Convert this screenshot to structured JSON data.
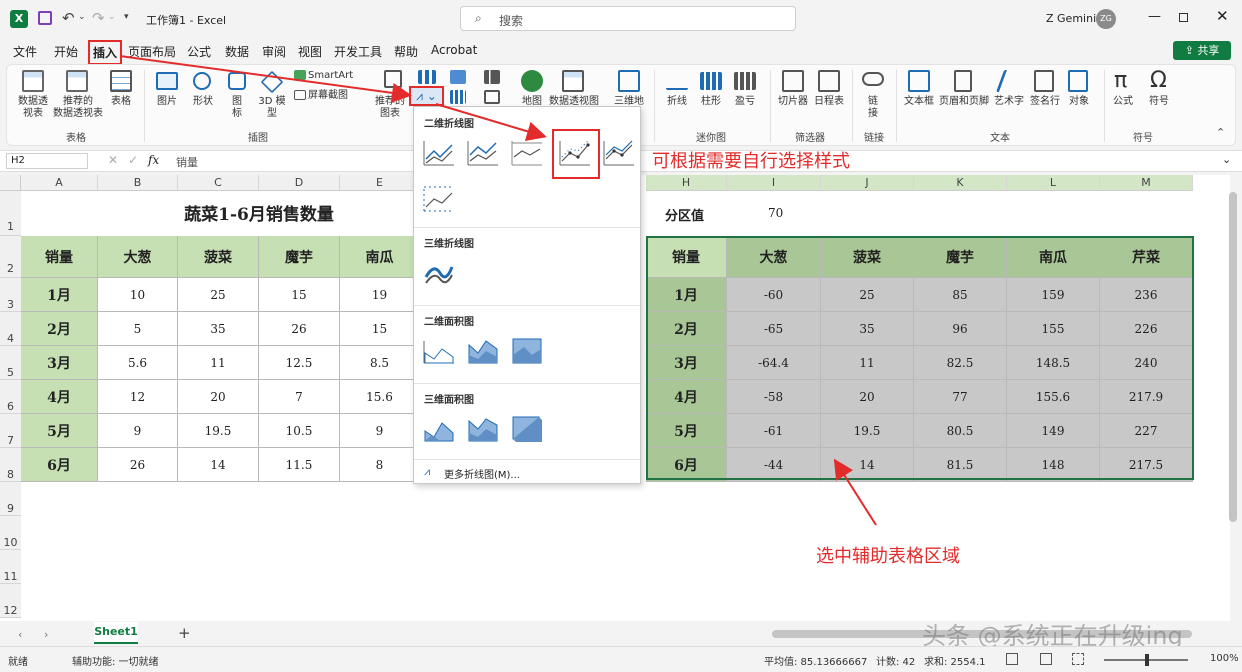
{
  "title_bar": {
    "window_title": "工作簿1 - Excel",
    "search_placeholder": "搜索",
    "user_name": "Z Gemini",
    "user_initials": "ZG"
  },
  "menu": {
    "tabs": [
      "文件",
      "开始",
      "插入",
      "页面布局",
      "公式",
      "数据",
      "审阅",
      "视图",
      "开发工具",
      "帮助",
      "Acrobat"
    ],
    "share": "共享"
  },
  "ribbon": {
    "buttons": {
      "pivot": "数据透\n视表",
      "rec_pivot": "推荐的\n数据透视表",
      "table": "表格",
      "picture": "图片",
      "shapes": "形状",
      "icons": "图\n标",
      "models3d": "3D 模\n型",
      "smartart": "SmartArt",
      "screenshot": "屏幕截图",
      "rec_chart": "推荐的\n图表",
      "map": "地图",
      "pivot_chart": "数据透视图",
      "chart3d": "三维地",
      "spark_line": "折线",
      "spark_col": "柱形",
      "spark_wl": "盈亏",
      "slicer": "切片器",
      "timeline": "日程表",
      "link": "链\n接",
      "textbox": "文本框",
      "header_footer": "页眉和页脚",
      "wordart": "艺术字",
      "signature": "签名行",
      "object": "对象",
      "formula": "公式",
      "symbol": "符号"
    },
    "groups": {
      "tables": "表格",
      "illustrations": "插图",
      "sparklines": "迷你图",
      "filters": "筛选器",
      "links": "链接",
      "text": "文本",
      "symbols": "符号"
    }
  },
  "formula_bar": {
    "name_box": "H2",
    "fx": "fx",
    "content": "销量"
  },
  "columns": [
    "A",
    "B",
    "C",
    "D",
    "E",
    "H",
    "I",
    "J",
    "K",
    "L",
    "M"
  ],
  "rows": [
    "1",
    "2",
    "3",
    "4",
    "5",
    "6",
    "7",
    "8",
    "9",
    "10",
    "11",
    "12"
  ],
  "left_table": {
    "title": "蔬菜1-6月销售数量",
    "headers": [
      "销量",
      "大葱",
      "菠菜",
      "魔芋",
      "南瓜"
    ],
    "rows": [
      [
        "1月",
        "10",
        "25",
        "15",
        "19"
      ],
      [
        "2月",
        "5",
        "35",
        "26",
        "15"
      ],
      [
        "3月",
        "5.6",
        "11",
        "12.5",
        "8.5"
      ],
      [
        "4月",
        "12",
        "20",
        "7",
        "15.6"
      ],
      [
        "5月",
        "9",
        "19.5",
        "10.5",
        "9"
      ],
      [
        "6月",
        "26",
        "14",
        "11.5",
        "8"
      ]
    ]
  },
  "right_table": {
    "partition_label": "分区值",
    "partition_value": "70",
    "headers": [
      "销量",
      "大葱",
      "菠菜",
      "魔芋",
      "南瓜",
      "芹菜"
    ],
    "rows": [
      [
        "1月",
        "-60",
        "25",
        "85",
        "159",
        "236"
      ],
      [
        "2月",
        "-65",
        "35",
        "96",
        "155",
        "226"
      ],
      [
        "3月",
        "-64.4",
        "11",
        "82.5",
        "148.5",
        "240"
      ],
      [
        "4月",
        "-58",
        "20",
        "77",
        "155.6",
        "217.9"
      ],
      [
        "5月",
        "-61",
        "19.5",
        "80.5",
        "149",
        "227"
      ],
      [
        "6月",
        "-44",
        "14",
        "81.5",
        "148",
        "217.5"
      ]
    ]
  },
  "dropdown": {
    "sec1": "二维折线图",
    "sec2": "三维折线图",
    "sec3": "二维面积图",
    "sec4": "三维面积图",
    "more": "更多折线图(M)..."
  },
  "annotations": {
    "style_tip": "可根据需要自行选择样式",
    "select_tip": "选中辅助表格区域"
  },
  "sheet": {
    "tab": "Sheet1",
    "add": "+"
  },
  "status": {
    "ready": "就绪",
    "accessibility": "辅助功能: 一切就绪",
    "average": "平均值: 85.13666667",
    "count": "计数: 42",
    "sum": "求和: 2554.1",
    "zoom": "100%"
  },
  "watermark": "头条 @系统正在升级ing"
}
